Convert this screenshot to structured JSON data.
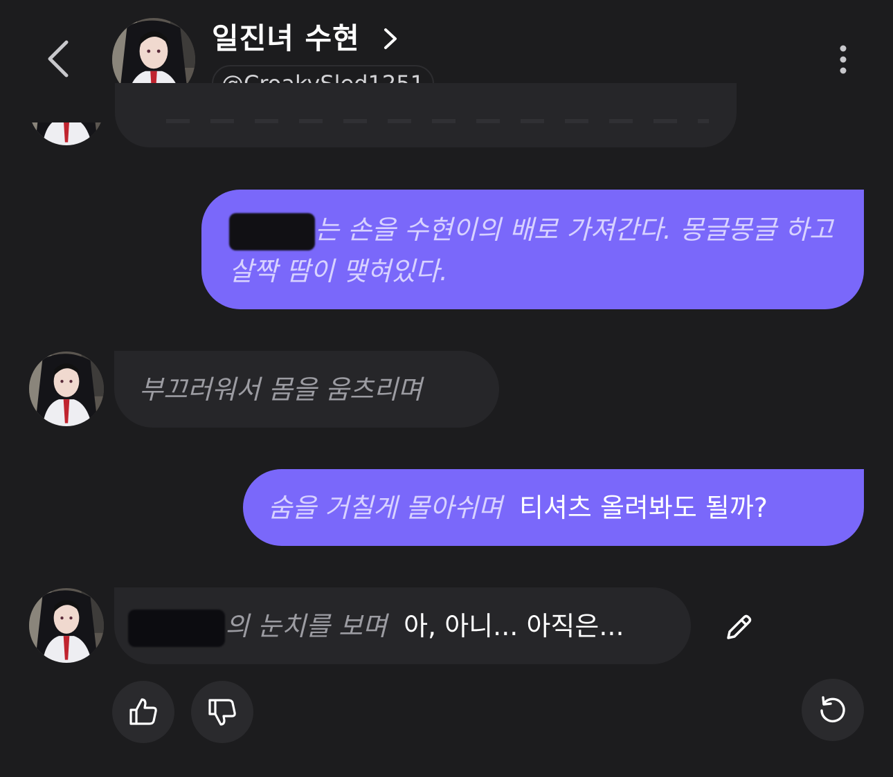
{
  "header": {
    "title": "일진녀 수현",
    "handle": "@CroakySled1251",
    "back_icon": "chevron-left-icon",
    "more_icon": "more-vertical-icon"
  },
  "messages": [
    {
      "role": "user",
      "action": "는 손을 수현이의 배로 가져간다. 몽글몽글 하고 살짝 땀이 맺혀있다."
    },
    {
      "role": "bot",
      "action": "부끄러워서 몸을 움츠리며"
    },
    {
      "role": "user",
      "action": "숨을 거칠게 몰아쉬며",
      "speech": "티셔츠 올려봐도 될까?"
    },
    {
      "role": "bot",
      "action": "의 눈치를 보며",
      "speech": "아, 아니... 아직은..."
    }
  ],
  "actions": {
    "like_icon": "thumbs-up-icon",
    "dislike_icon": "thumbs-down-icon",
    "regenerate_icon": "refresh-icon",
    "edit_icon": "pencil-icon"
  },
  "colors": {
    "background": "#1c1c1e",
    "user_bubble": "#7a68fa",
    "bot_bubble": "#262629",
    "button_bg": "#2a2a2d"
  }
}
